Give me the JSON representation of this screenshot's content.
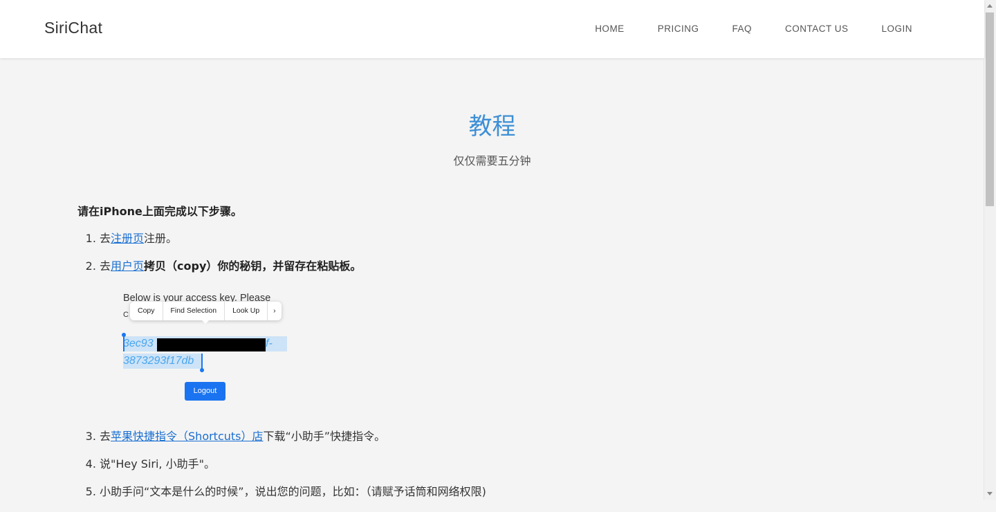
{
  "brand": "SiriChat",
  "nav": {
    "home": "HOME",
    "pricing": "PRICING",
    "faq": "FAQ",
    "contact": "CONTACT US",
    "login": "LOGIN"
  },
  "hero": {
    "title": "教程",
    "subtitle": "仅仅需要五分钟"
  },
  "intro": "请在iPhone上面完成以下步骤。",
  "steps": {
    "s1": {
      "pre": "去",
      "link": "注册页",
      "post": "注册。"
    },
    "s2": {
      "pre": "去",
      "link": "用户页",
      "post": "拷贝（copy）你的秘钥，并留存在粘贴板。"
    },
    "s3": {
      "pre": "去",
      "link": "苹果快捷指令（Shortcuts）店",
      "post": "下载“小助手”快捷指令。"
    },
    "s4": {
      "text": "说\"Hey Siri, 小助手\"。"
    },
    "s5": {
      "text": "小助手问“文本是什么的时候”，说出您的问题，比如：（请赋予话筒和网络权限)"
    }
  },
  "illustration": {
    "heading": "Below is your access key. Please",
    "partial_letter": "C",
    "menu": [
      "Copy",
      "Find Selection",
      "Look Up"
    ],
    "menu_more": "›",
    "key_line1_prefix": "3ec93",
    "key_line1_suffix": "f-",
    "key_line2": "3873293f17db",
    "logout": "Logout"
  },
  "colors": {
    "accent": "#3d8fd6",
    "link": "#1a6fd1",
    "button": "#1a73f0",
    "background": "#f4f4f4"
  }
}
